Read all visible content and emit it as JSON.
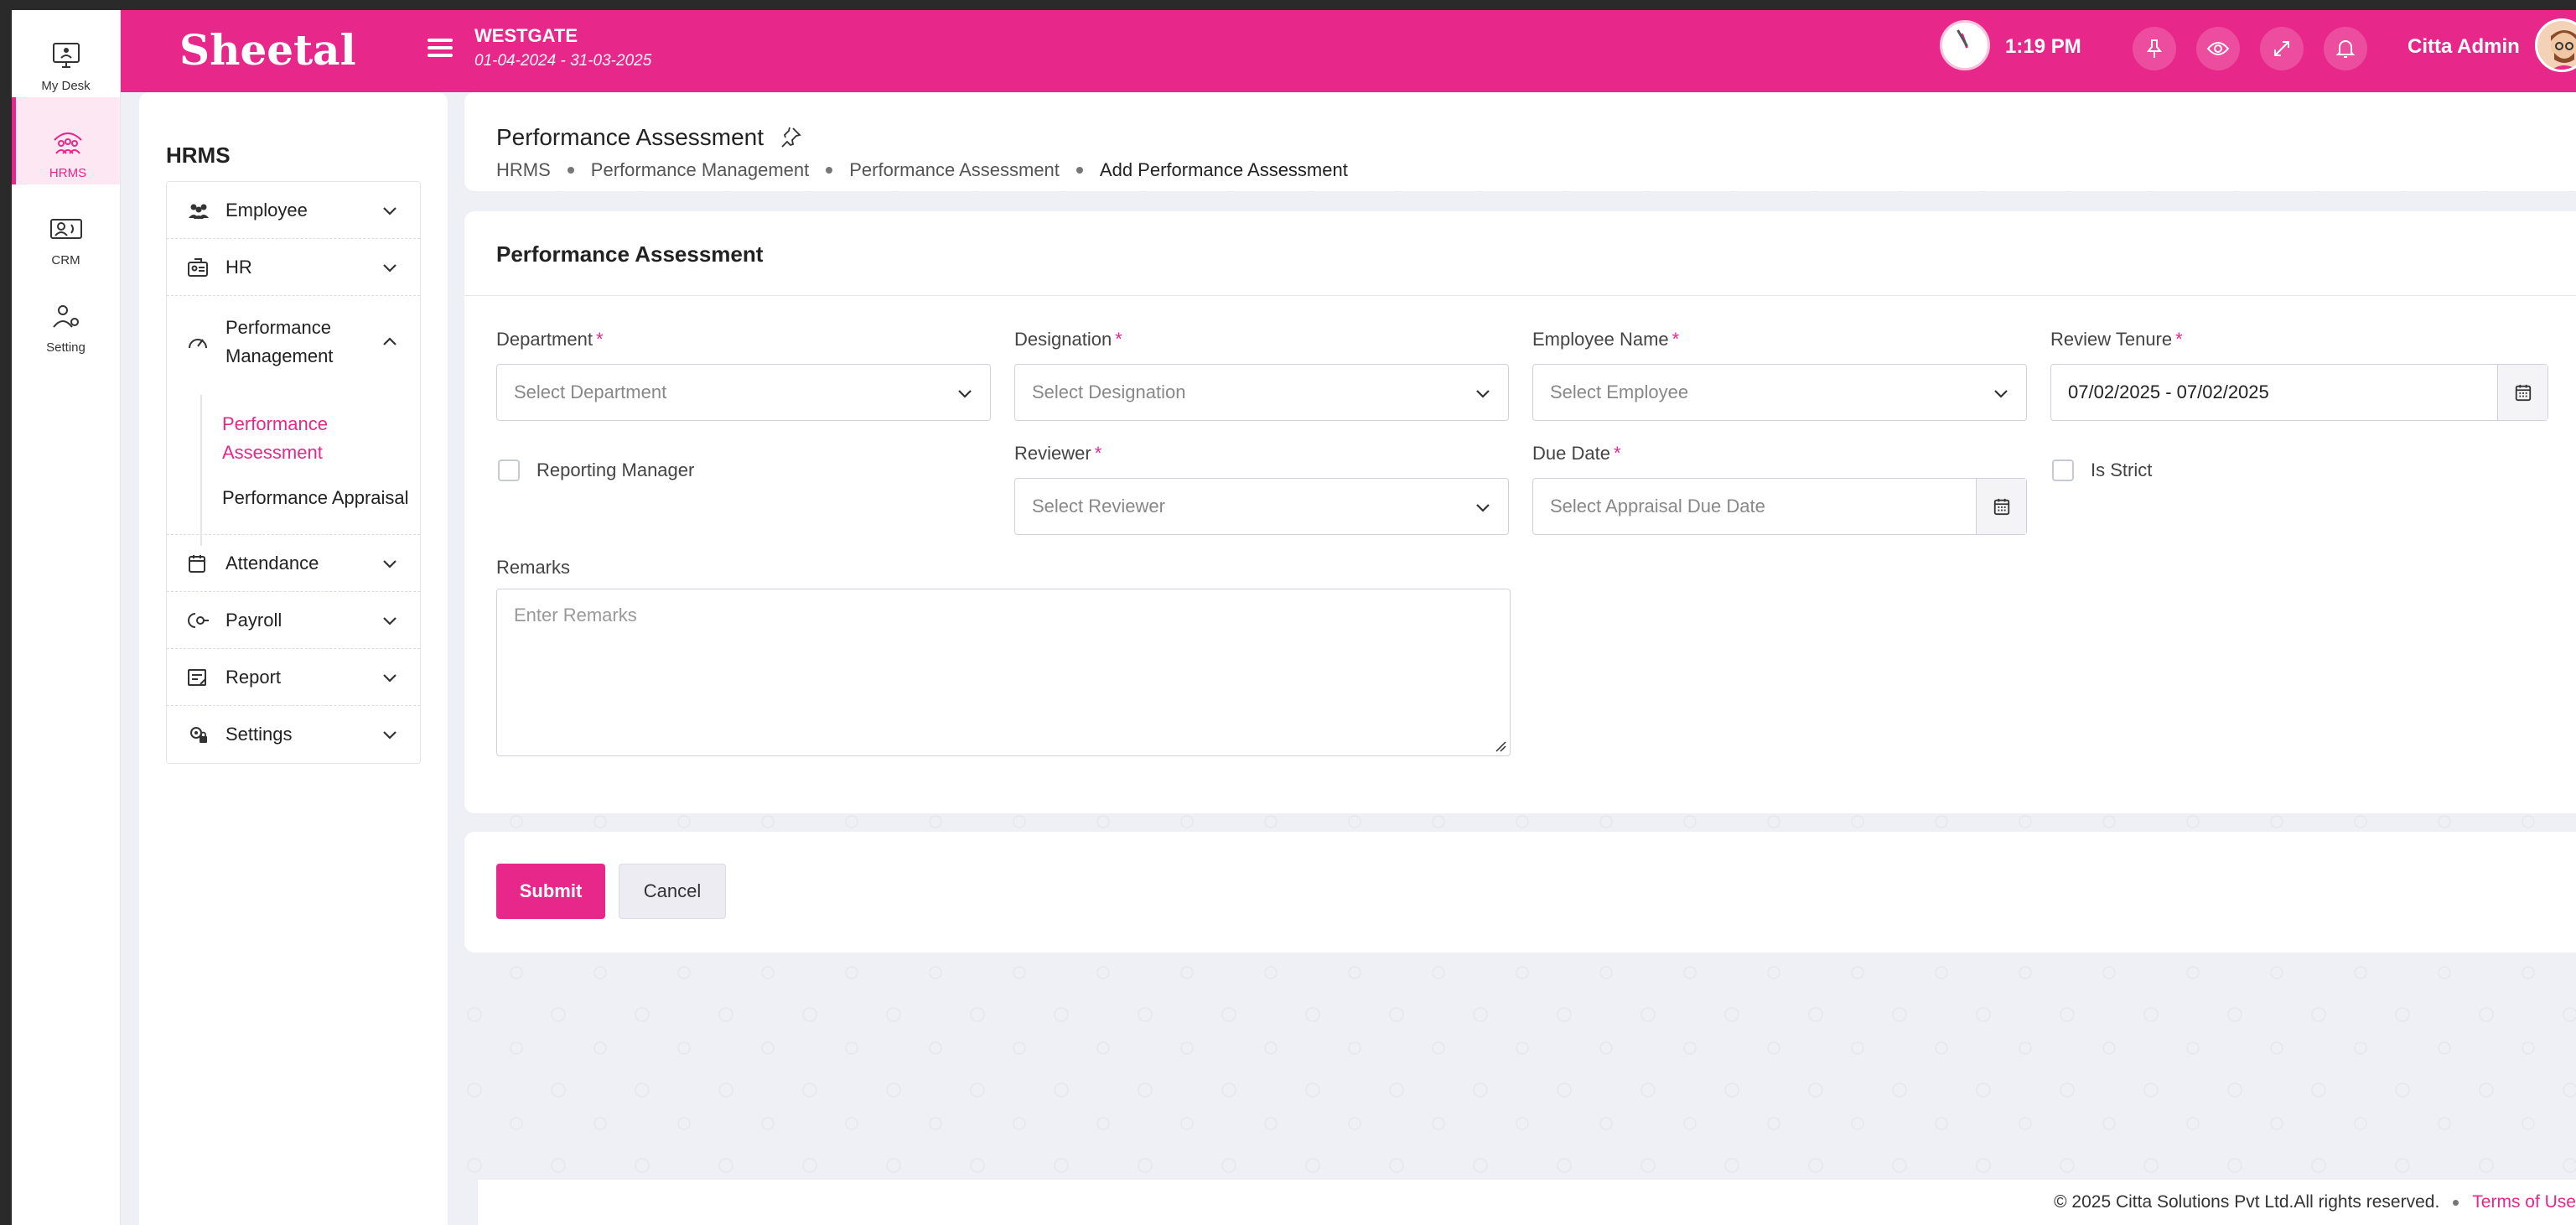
{
  "rail": {
    "items": [
      {
        "label": "My Desk",
        "icon": "desk-monitor-icon"
      },
      {
        "label": "HRMS",
        "icon": "hrms-people-icon"
      },
      {
        "label": "CRM",
        "icon": "crm-contact-icon"
      },
      {
        "label": "Setting",
        "icon": "user-settings-icon"
      }
    ]
  },
  "topbar": {
    "brand": "Sheetal",
    "org_name": "WESTGATE",
    "org_period": "01-04-2024 - 31-03-2025",
    "time": "1:19 PM",
    "user_name": "Citta Admin",
    "accent_color": "#e8278a"
  },
  "sidebar": {
    "title": "HRMS",
    "items": [
      {
        "label": "Employee",
        "icon": "employees-icon"
      },
      {
        "label": "HR",
        "icon": "hr-icon"
      },
      {
        "label": "Performance Management",
        "icon": "gauge-icon"
      },
      {
        "label": "Attendance",
        "icon": "calendar-icon"
      },
      {
        "label": "Payroll",
        "icon": "payroll-icon"
      },
      {
        "label": "Report",
        "icon": "report-icon"
      },
      {
        "label": "Settings",
        "icon": "settings-lock-icon"
      }
    ],
    "sub_items": [
      {
        "label": "Performance Assessment",
        "active": true
      },
      {
        "label": "Performance Appraisal",
        "active": false
      }
    ]
  },
  "header": {
    "title": "Performance Assessment",
    "breadcrumbs": [
      "HRMS",
      "Performance Management",
      "Performance Assessment",
      "Add Performance Assessment"
    ]
  },
  "form": {
    "title": "Performance Assessment",
    "department": {
      "label": "Department",
      "placeholder": "Select Department"
    },
    "designation": {
      "label": "Designation",
      "placeholder": "Select Designation"
    },
    "employee": {
      "label": "Employee Name",
      "placeholder": "Select Employee"
    },
    "review_tenure": {
      "label": "Review Tenure",
      "value": "07/02/2025 - 07/02/2025"
    },
    "reporting_manager": {
      "label": "Reporting Manager",
      "checked": false
    },
    "reviewer": {
      "label": "Reviewer",
      "placeholder": "Select Reviewer"
    },
    "due_date": {
      "label": "Due Date",
      "placeholder": "Select Appraisal Due Date"
    },
    "is_strict": {
      "label": "Is Strict",
      "checked": false
    },
    "remarks": {
      "label": "Remarks",
      "placeholder": "Enter Remarks"
    },
    "required_mark": "*"
  },
  "actions": {
    "submit": "Submit",
    "cancel": "Cancel"
  },
  "footer": {
    "copyright": "© 2025 Citta Solutions Pvt Ltd.All rights reserved.",
    "terms": "Terms of Use"
  }
}
